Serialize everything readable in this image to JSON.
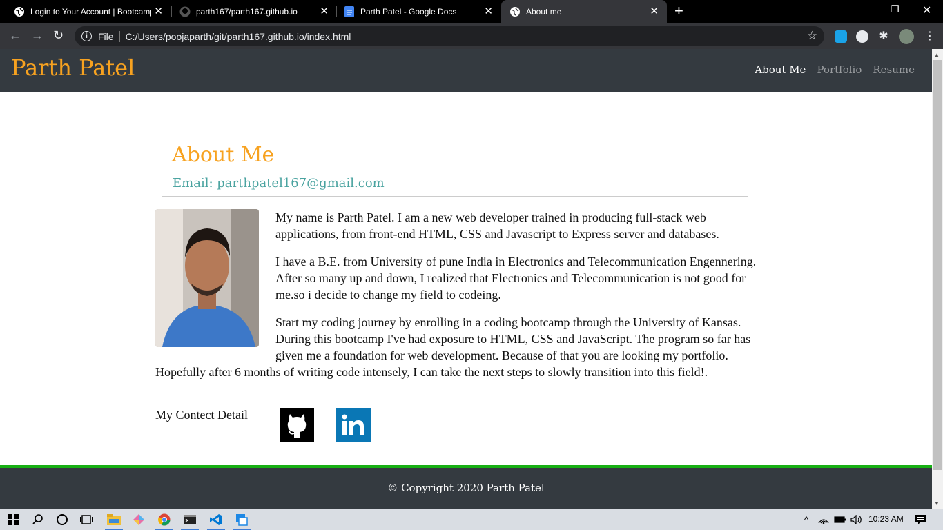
{
  "browser": {
    "tabs": [
      {
        "title": "Login to Your Account | Bootcamp",
        "favicon": "globe-icon"
      },
      {
        "title": "parth167/parth167.github.io",
        "favicon": "github-icon"
      },
      {
        "title": "Parth Patel - Google Docs",
        "favicon": "docs-icon"
      },
      {
        "title": "About me",
        "favicon": "globe-icon",
        "active": true
      }
    ],
    "address": {
      "scheme_label": "File",
      "url": "C:/Users/poojaparth/git/parth167.github.io/index.html"
    }
  },
  "site": {
    "brand": "Parth Patel",
    "nav": [
      {
        "label": "About Me",
        "active": true
      },
      {
        "label": "Portfolio"
      },
      {
        "label": "Resume"
      }
    ],
    "heading": "About Me",
    "email": "Email: parthpatel167@gmail.com",
    "paragraphs": [
      "My name is Parth Patel. I am a new web developer trained in producing full-stack web applications, from front-end HTML, CSS and Javascript to Express server and databases.",
      "I have a B.E. from University of pune India in Electronics and Telecommunication Engennering. After so many up and down, I realized that Electronics and Telecommunication is not good for me.so i decide to change my field to codeing.",
      "Start my coding journey by enrolling in a coding bootcamp through the University of Kansas. During this bootcamp I've had exposure to HTML, CSS and JavaScript. The program so far has given me a foundation for web development. Because of that you are looking my portfolio. Hopefully after 6 months of writing code intensely, I can take the next steps to slowly transition into this field!."
    ],
    "contact_label": "My Contect Detail",
    "footer": "© Copyright 2020 Parth Patel",
    "colors": {
      "brand": "#f7a220",
      "email": "#4aa3a0",
      "navbar": "#343a40",
      "footer_border": "#18b014"
    }
  },
  "taskbar": {
    "clock": "10:23 AM"
  }
}
